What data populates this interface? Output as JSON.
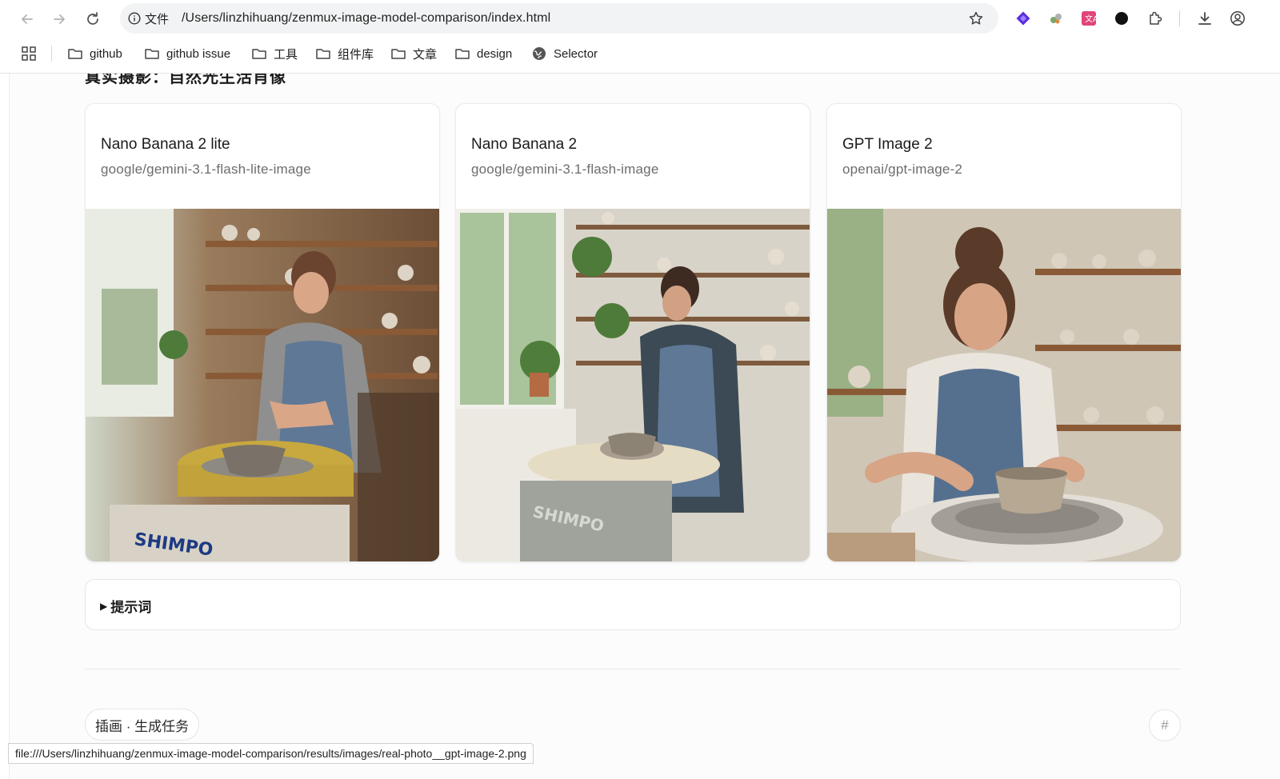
{
  "browser": {
    "site_info_label": "文件",
    "url": "/Users/linzhihuang/zenmux-image-model-comparison/index.html",
    "bookmarks": [
      {
        "label": "github",
        "icon": "folder-icon"
      },
      {
        "label": "github issue",
        "icon": "folder-icon"
      },
      {
        "label": "工具",
        "icon": "folder-icon"
      },
      {
        "label": "组件库",
        "icon": "folder-icon"
      },
      {
        "label": "文章",
        "icon": "folder-icon"
      },
      {
        "label": "design",
        "icon": "folder-icon"
      },
      {
        "label": "Selector",
        "icon": "globe-icon"
      }
    ],
    "status_url": "file:///Users/linzhihuang/zenmux-image-model-comparison/results/images/real-photo__gpt-image-2.png"
  },
  "section": {
    "title": "真实摄影：自然光生活肖像"
  },
  "cards": [
    {
      "title": "Nano Banana 2 lite",
      "model_id": "google/gemini-3.1-flash-lite-image",
      "image_alt": "woman at pottery wheel with SHIMPO machine"
    },
    {
      "title": "Nano Banana 2",
      "model_id": "google/gemini-3.1-flash-image",
      "image_alt": "woman shaping bowl near window with plants"
    },
    {
      "title": "GPT Image 2",
      "model_id": "openai/gpt-image-2",
      "image_alt": "woman trimming bowl on wheel close-up"
    }
  ],
  "prompt": {
    "label": "提示词"
  },
  "footer": {
    "tag": "插画 · 生成任务",
    "anchor": "#"
  },
  "colors": {
    "accent_ext": "#5b2ee0",
    "translate_ext": "#e0457b"
  }
}
